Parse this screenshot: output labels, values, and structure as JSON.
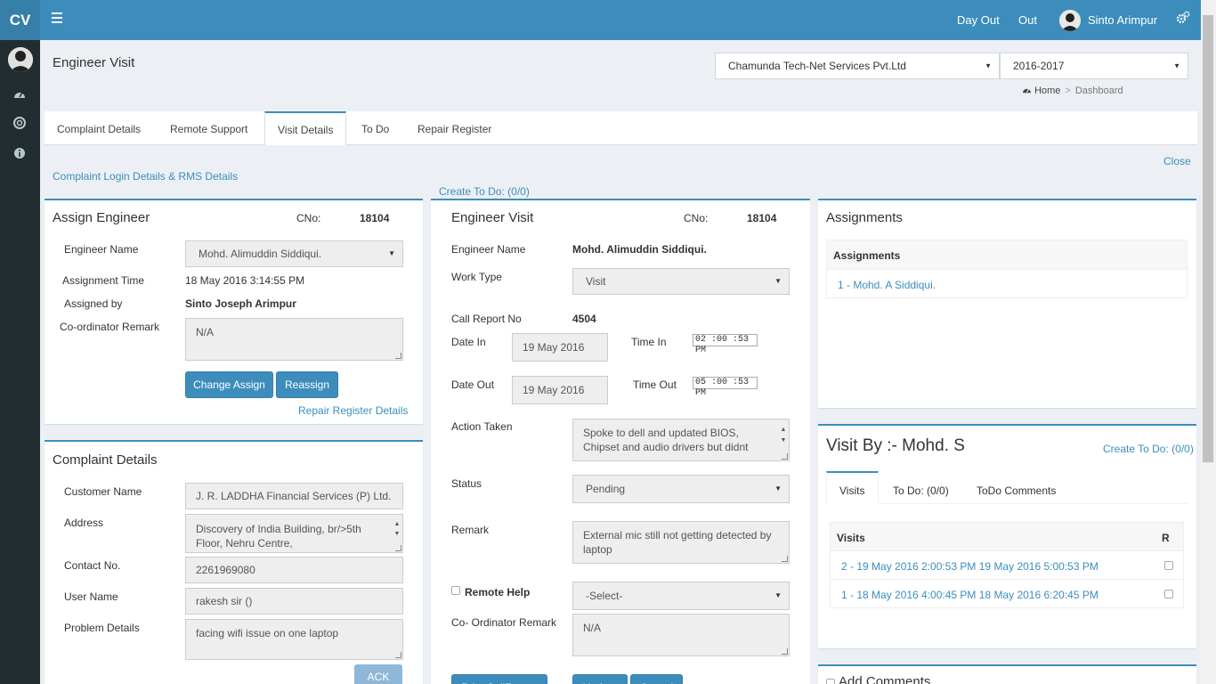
{
  "header": {
    "logo": "CV",
    "day_out": "Day Out",
    "out": "Out",
    "user_name": "Sinto Arimpur",
    "menu_icon": "bars-icon",
    "settings_icon": "gears-icon"
  },
  "sidebar": {
    "icons": [
      "dashboard-icon",
      "support-icon",
      "info-icon"
    ]
  },
  "page": {
    "title": "Engineer Visit",
    "company_select": "Chamunda Tech-Net Services Pvt.Ltd",
    "year_select": "2016-2017",
    "breadcrumb_home": "Home",
    "breadcrumb_sep": ">",
    "breadcrumb_current": "Dashboard",
    "close": "Close",
    "complaint_link": "Complaint Login Details & RMS Details",
    "create_todo": "Create To Do: (0/0)"
  },
  "tabs": [
    {
      "label": "Complaint Details"
    },
    {
      "label": "Remote Support"
    },
    {
      "label": "Visit Details"
    },
    {
      "label": "To Do"
    },
    {
      "label": "Repair Register"
    }
  ],
  "assign": {
    "title": "Assign Engineer",
    "cno_label": "CNo:",
    "cno": "18104",
    "engineer_label": "Engineer Name",
    "engineer": "Mohd. Alimuddin Siddiqui.",
    "time_label": "Assignment Time",
    "time": "18 May 2016 3:14:55 PM",
    "by_label": "Assigned by",
    "by": "Sinto Joseph Arimpur",
    "remark_label": "Co-ordinator Remark",
    "remark": "N/A",
    "change_btn": "Change Assign",
    "reassign_btn": "Reassign",
    "repair_link": "Repair Register Details"
  },
  "complaint": {
    "title": "Complaint Details",
    "customer_label": "Customer Name",
    "customer": "J. R. LADDHA Financial Services (P) Ltd.",
    "address_label": "Address",
    "address": "Discovery of India Building, br/>5th Floor, Nehru Centre,",
    "contact_label": "Contact No.",
    "contact": "2261969080",
    "user_label": "User Name",
    "user": "rakesh sir ()",
    "problem_label": "Problem Details",
    "problem": "facing  wifi issue on one laptop",
    "ack_btn": "ACK"
  },
  "visit": {
    "title": "Engineer Visit",
    "cno_label": "CNo:",
    "cno": "18104",
    "engineer_label": "Engineer Name",
    "engineer": "Mohd. Alimuddin Siddiqui.",
    "worktype_label": "Work Type",
    "worktype": "Visit",
    "callreport_label": "Call Report No",
    "callreport": "4504",
    "datein_label": "Date In",
    "datein": "19 May 2016",
    "timein_label": "Time In",
    "timein": "02 :00 :53 PM",
    "dateout_label": "Date Out",
    "dateout": "19 May 2016",
    "timeout_label": "Time Out",
    "timeout": "05 :00 :53 PM",
    "action_label": "Action Taken",
    "action": "Spoke to dell and updated BIOS, Chipset and audio drivers but didnt",
    "status_label": "Status",
    "status": "Pending",
    "remark_label": "Remark",
    "remark": "External mic still not getting detected by laptop",
    "remote_label": "Remote Help",
    "remote_select": "-Select-",
    "coord_label": "Co- Ordinator Remark",
    "coord": "N/A",
    "print_btn": "Print CallReport",
    "update_btn": "Update",
    "cancel_btn": "Cancel"
  },
  "assignments": {
    "title": "Assignments",
    "inner_title": "Assignments",
    "items": [
      "1 - Mohd. A Siddiqui."
    ]
  },
  "visitby": {
    "title": "Visit By :- Mohd. S",
    "create_todo": "Create To Do: (0/0)",
    "tabs": [
      "Visits",
      "To Do: (0/0)",
      "ToDo Comments"
    ],
    "col_visits": "Visits",
    "col_r": "R",
    "rows": [
      "2 - 19 May 2016 2:00:53 PM 19 May 2016 5:00:53 PM",
      "1 - 18 May 2016 4:00:45 PM 18 May 2016 6:20:45 PM"
    ]
  },
  "comments": {
    "title": "Add Comments"
  }
}
